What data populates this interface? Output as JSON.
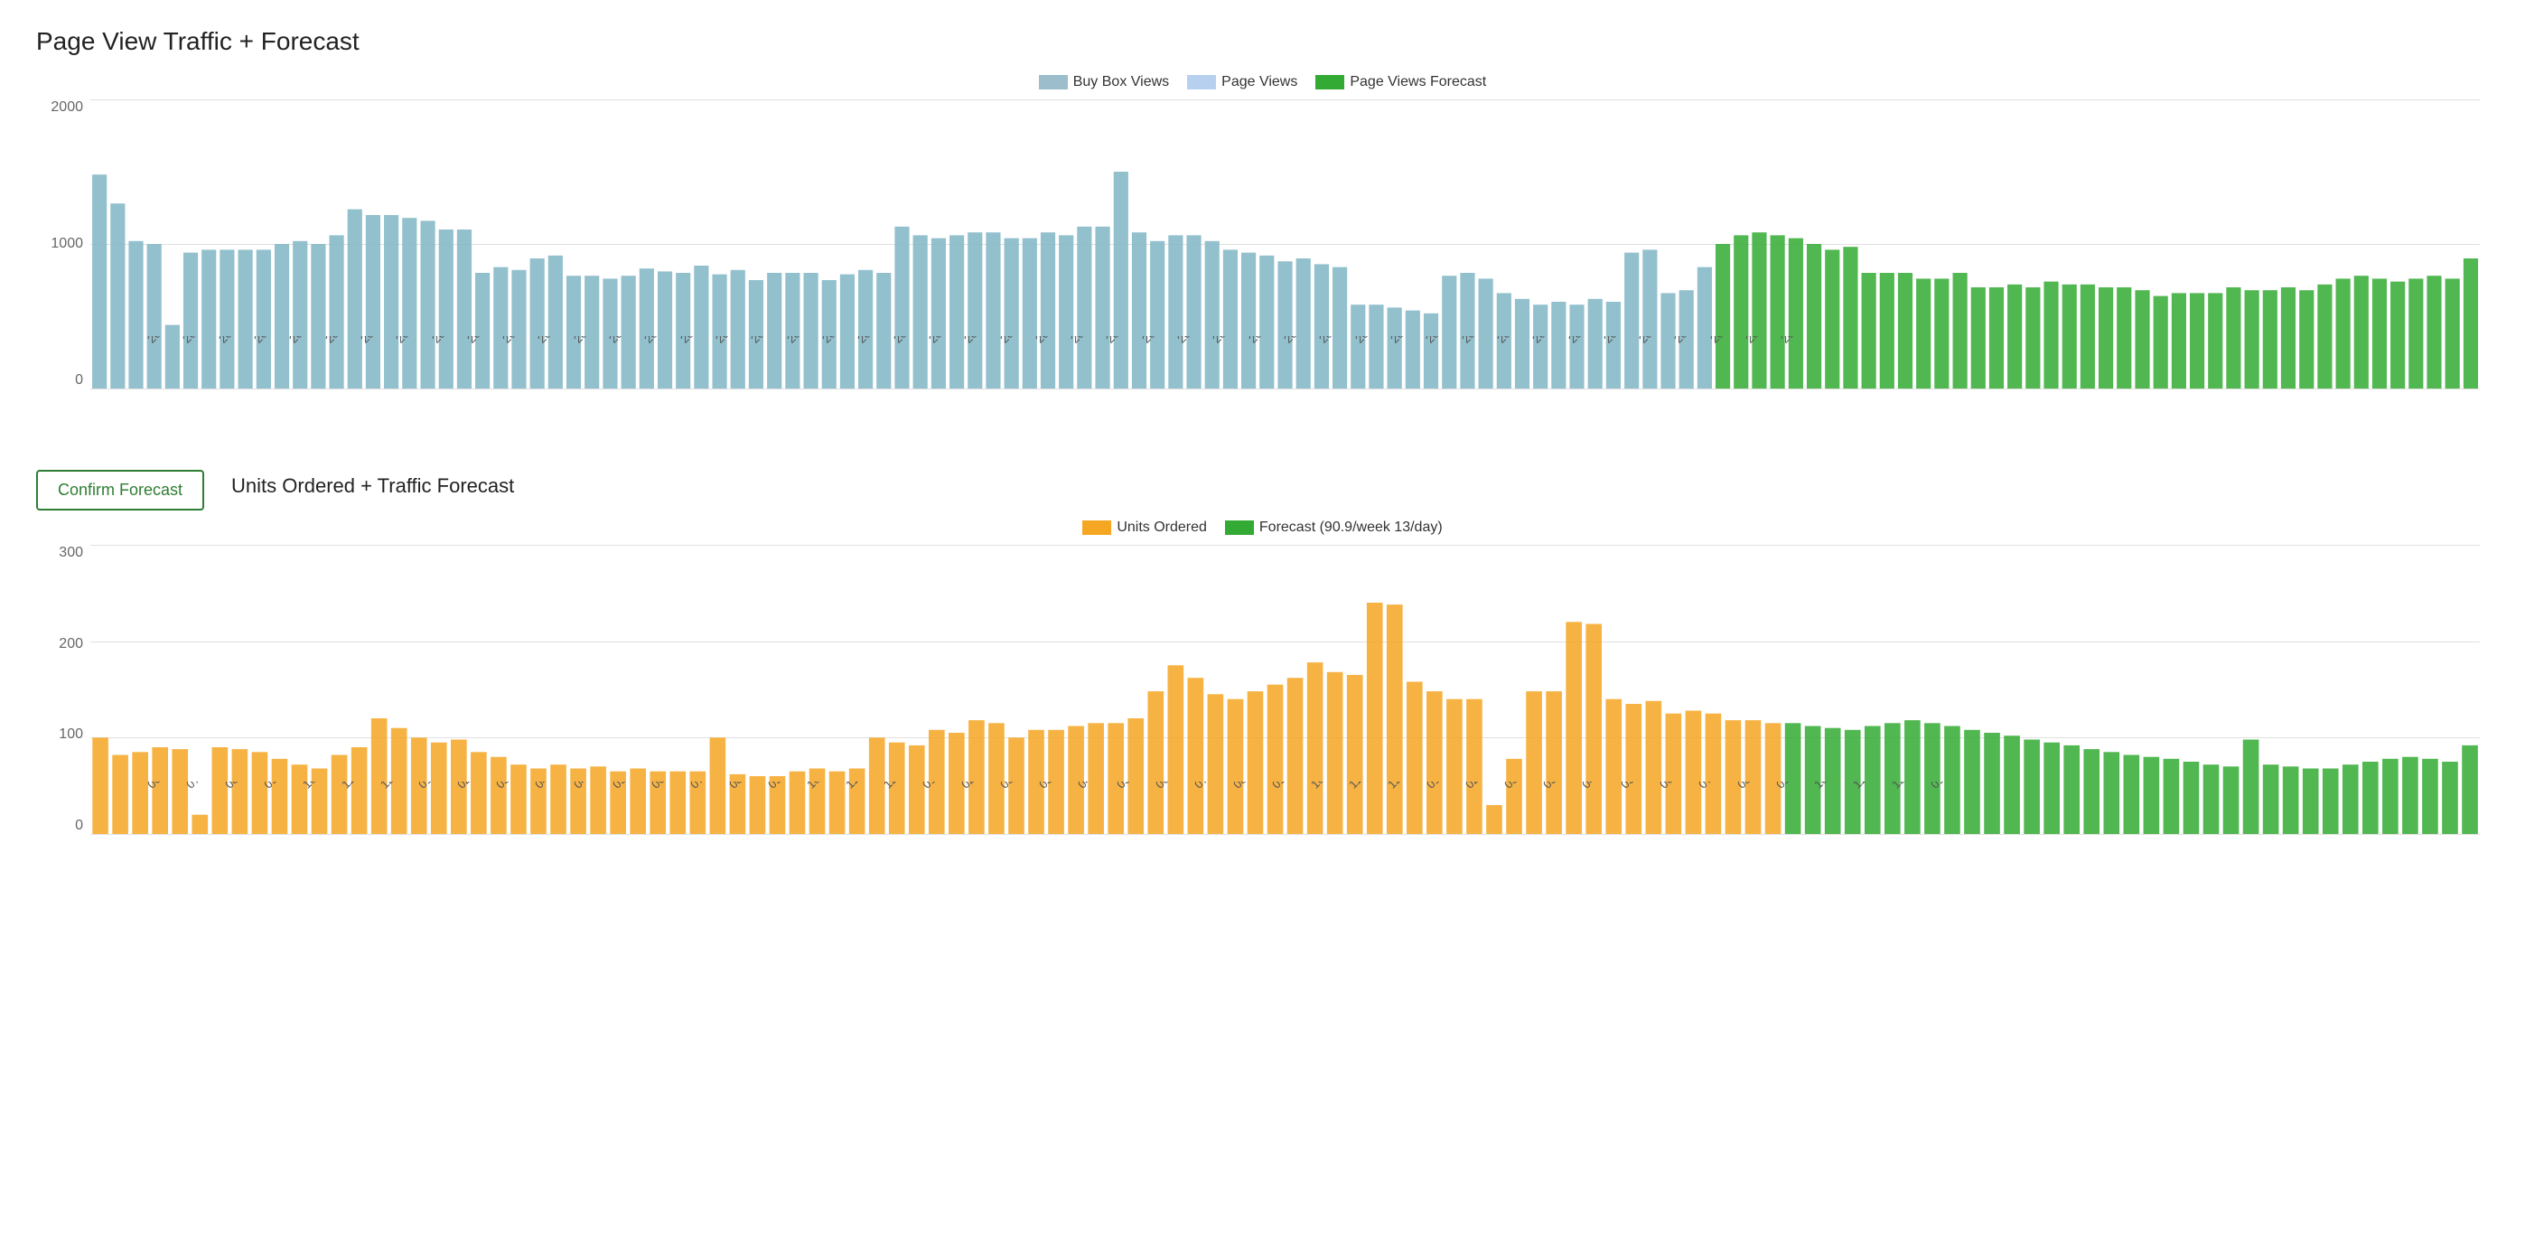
{
  "page": {
    "title": "Page View Traffic + Forecast"
  },
  "chart1": {
    "title": "Page View Traffic + Forecast",
    "legend": [
      {
        "label": "Buy Box Views",
        "color": "#7baabe",
        "colorFill": "#9bbdcc"
      },
      {
        "label": "Page Views",
        "color": "#a8c4e0",
        "colorFill": "#b8d0f0"
      },
      {
        "label": "Page Views Forecast",
        "color": "#33aa33",
        "colorFill": "#33aa33"
      }
    ],
    "yMax": 2000,
    "yLabels": [
      "2000",
      "1000",
      "0"
    ],
    "xLabels": [
      "2022-06-26",
      "2022-07-24",
      "2022-08-21",
      "2022-09-18",
      "2022-10-16",
      "2022-11-13",
      "2022-12-11",
      "2023-01-08",
      "2023-02-05",
      "2023-03-05",
      "2023-04-02",
      "2023-04-30",
      "2023-05-28",
      "2023-06-25",
      "2023-07-23",
      "2023-08-20",
      "2023-09-17",
      "2023-10-15",
      "2023-11-12",
      "2023-12-10",
      "2024-01-07",
      "2024-02-04",
      "2024-03-03",
      "2024-03-31",
      "2024-04-28",
      "2024-05-26",
      "2024-06-23",
      "2024-07-21",
      "2024-08-18",
      "2024-09-15",
      "2024-10-13",
      "2024-11-10",
      "2024-12-08",
      "2025-01-05",
      "2025-02-02",
      "2025-03-02",
      "2025-03-30",
      "2025-04-27",
      "2025-05-25",
      "2025-06-22",
      "2025-07-20",
      "2025-08-17",
      "2025-09-14",
      "2025-10-12",
      "2025-11-09",
      "2025-12-07",
      "2026-01-04"
    ]
  },
  "chart2": {
    "title": "Units Ordered + Traffic Forecast",
    "legend": [
      {
        "label": "Units Ordered",
        "color": "#f5a623",
        "colorFill": "#f5a623"
      },
      {
        "label": "Forecast (90.9/week 13/day)",
        "color": "#33aa33",
        "colorFill": "#33aa33"
      }
    ],
    "yMax": 300,
    "yLabels": [
      "300",
      "200",
      "100",
      "0"
    ],
    "xLabels": [
      "06-26",
      "07-24",
      "08-21",
      "09-18",
      "10-16",
      "11-13",
      "12-11",
      "01-08",
      "02-05",
      "03-05",
      "04-02",
      "04-30",
      "05-28",
      "06-25",
      "07-23",
      "08-20",
      "09-17",
      "10-15",
      "11-12",
      "12-10",
      "01-07",
      "02-04",
      "03-03",
      "03-31",
      "04-28",
      "05-26",
      "06-23",
      "07-21",
      "08-18",
      "09-15",
      "10-13",
      "11-10",
      "12-08",
      "01-05",
      "02-02",
      "03-02",
      "03-30",
      "04-27",
      "05-25",
      "06-22",
      "07-20",
      "08-17",
      "09-14",
      "10-12",
      "11-09",
      "12-07",
      "01-04"
    ]
  },
  "buttons": {
    "confirm_forecast": "Confirm Forecast"
  }
}
